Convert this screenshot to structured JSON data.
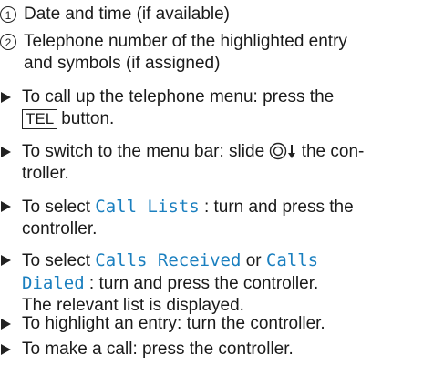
{
  "legend": [
    {
      "num": "1",
      "text": "Date and time (if available)"
    },
    {
      "num": "2",
      "line1": "Telephone number of the highlighted entry",
      "line2": "and symbols (if assigned)"
    }
  ],
  "steps": {
    "s1": {
      "l1": "To call up the telephone menu: press the",
      "key": "TEL",
      "l2": "button."
    },
    "s2": {
      "l1a": "To switch to the menu bar: slide",
      "l1b": "the con-",
      "l2": "troller."
    },
    "s3": {
      "a": "To select",
      "mono": "Call Lists",
      "b": ": turn and press the",
      "l2": "controller."
    },
    "s4": {
      "a": "To select",
      "mono1": "Calls Received",
      "or": "or",
      "mono2": "Calls",
      "mono3": "Dialed",
      "b": ": turn and press the controller.",
      "l3": "The relevant list is displayed."
    },
    "s5": {
      "text": "To highlight an entry: turn the controller."
    },
    "s6": {
      "text": "To make a call: press the controller."
    }
  }
}
